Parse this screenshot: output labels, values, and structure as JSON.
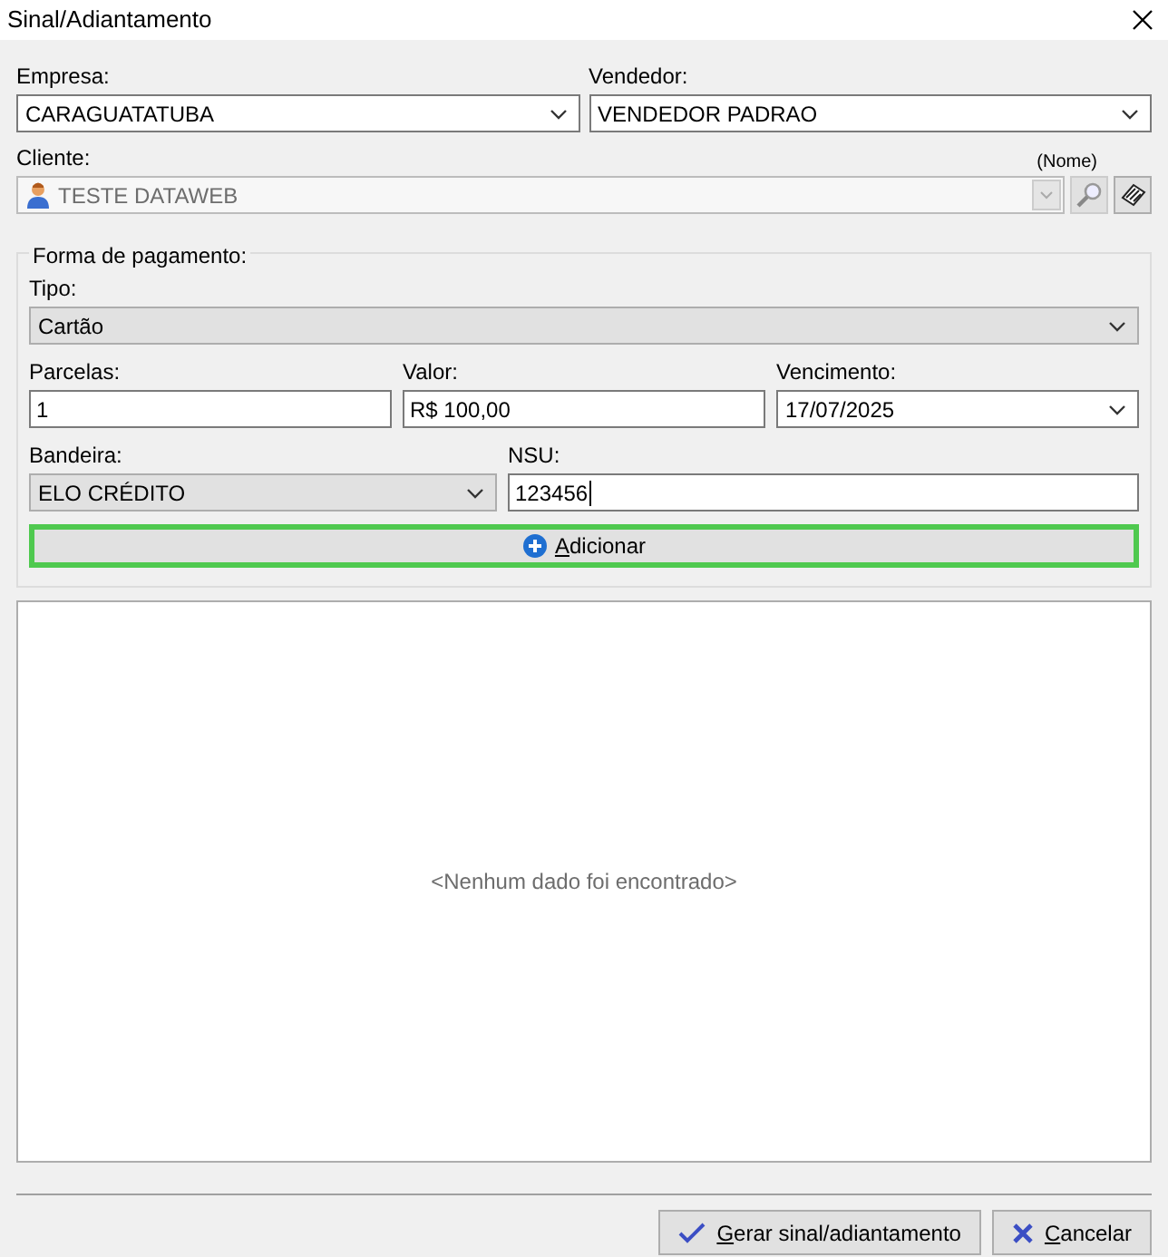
{
  "window": {
    "title": "Sinal/Adiantamento"
  },
  "empresa": {
    "label": "Empresa:",
    "value": "CARAGUATATUBA"
  },
  "vendedor": {
    "label": "Vendedor:",
    "value": "VENDEDOR PADRAO"
  },
  "cliente": {
    "label": "Cliente:",
    "hint": "(Nome)",
    "value": "TESTE DATAWEB",
    "disabled": true
  },
  "payment": {
    "legend": "Forma de pagamento:",
    "tipo": {
      "label": "Tipo:",
      "value": "Cartão"
    },
    "parcelas": {
      "label": "Parcelas:",
      "value": "1"
    },
    "valor": {
      "label": "Valor:",
      "value": "R$ 100,00"
    },
    "vencimento": {
      "label": "Vencimento:",
      "value": "17/07/2025"
    },
    "bandeira": {
      "label": "Bandeira:",
      "value": "ELO CRÉDITO"
    },
    "nsu": {
      "label": "NSU:",
      "value": "123456",
      "focused": true
    },
    "add_button": {
      "label": "Adicionar",
      "focused": true
    }
  },
  "grid": {
    "empty_message": "<Nenhum dado foi encontrado>"
  },
  "buttons": [
    {
      "kind": "confirm",
      "label": "Gerar sinal/adiantamento"
    },
    {
      "kind": "cancel",
      "label": "Cancelar"
    }
  ]
}
